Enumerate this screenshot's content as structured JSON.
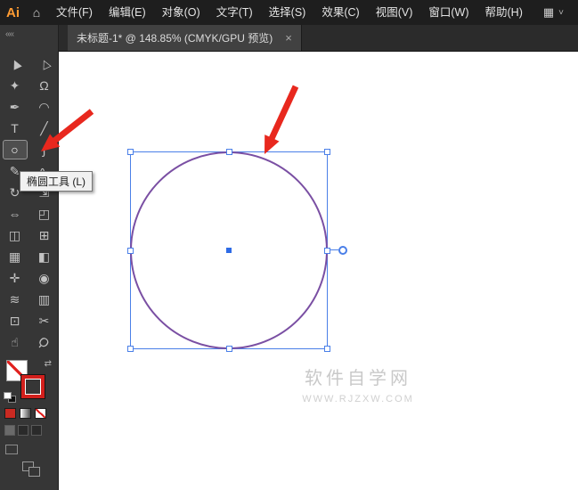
{
  "menubar": {
    "logo_text": "Ai",
    "items": [
      "文件(F)",
      "编辑(E)",
      "对象(O)",
      "文字(T)",
      "选择(S)",
      "效果(C)",
      "视图(V)",
      "窗口(W)",
      "帮助(H)"
    ]
  },
  "icons": {
    "home": "⌂",
    "workspace_grid": "▦",
    "chevron_down": "˅",
    "collapse": "««",
    "swap_arrows": "⇄",
    "close": "×"
  },
  "tabbar": {
    "active_tab": {
      "title": "未标题-1* @ 148.85% (CMYK/GPU 预览)"
    }
  },
  "toolbar": {
    "tools": [
      {
        "name": "selection-tool",
        "glyph": "▶",
        "selected": false
      },
      {
        "name": "direct-selection-tool",
        "glyph": "▷",
        "selected": false
      },
      {
        "name": "magic-wand-tool",
        "glyph": "✦",
        "selected": false
      },
      {
        "name": "lasso-tool",
        "glyph": "Ω",
        "selected": false
      },
      {
        "name": "pen-tool",
        "glyph": "✒",
        "selected": false
      },
      {
        "name": "curvature-tool",
        "glyph": "◠",
        "selected": false
      },
      {
        "name": "type-tool",
        "glyph": "T",
        "selected": false
      },
      {
        "name": "line-segment-tool",
        "glyph": "╱",
        "selected": false
      },
      {
        "name": "ellipse-tool",
        "glyph": "○",
        "selected": true
      },
      {
        "name": "paintbrush-tool",
        "glyph": "ʃ",
        "selected": false
      },
      {
        "name": "pencil-tool",
        "glyph": "✎",
        "selected": false
      },
      {
        "name": "shaper-tool",
        "glyph": "∿",
        "selected": false
      },
      {
        "name": "rotate-tool",
        "glyph": "↻",
        "selected": false
      },
      {
        "name": "scale-tool",
        "glyph": "⇲",
        "selected": false
      },
      {
        "name": "width-tool",
        "glyph": "⇔",
        "selected": false
      },
      {
        "name": "free-transform-tool",
        "glyph": "◰",
        "selected": false
      },
      {
        "name": "shape-builder-tool",
        "glyph": "◫",
        "selected": false
      },
      {
        "name": "perspective-grid-tool",
        "glyph": "⊞",
        "selected": false
      },
      {
        "name": "mesh-tool",
        "glyph": "▦",
        "selected": false
      },
      {
        "name": "gradient-tool",
        "glyph": "◧",
        "selected": false
      },
      {
        "name": "eyedropper-tool",
        "glyph": "✛",
        "selected": false
      },
      {
        "name": "blend-tool",
        "glyph": "◉",
        "selected": false
      },
      {
        "name": "symbol-sprayer-tool",
        "glyph": "≋",
        "selected": false
      },
      {
        "name": "column-graph-tool",
        "glyph": "▥",
        "selected": false
      },
      {
        "name": "artboard-tool",
        "glyph": "⊡",
        "selected": false
      },
      {
        "name": "slice-tool",
        "glyph": "✂",
        "selected": false
      },
      {
        "name": "hand-tool",
        "glyph": "☝",
        "selected": false
      },
      {
        "name": "zoom-tool",
        "glyph": "Ϙ",
        "selected": false
      }
    ]
  },
  "tooltip": {
    "text": "椭圆工具 (L)"
  },
  "canvas": {
    "watermark": {
      "line1": "软件自学网",
      "line2": "WWW.RJZXW.COM"
    }
  },
  "colors": {
    "annotation_arrow_red": "#e8281e",
    "circle_stroke_purple": "#7a4fa3",
    "selection_blue": "#4a7fe8",
    "swatch_red": "#d21f1c"
  }
}
